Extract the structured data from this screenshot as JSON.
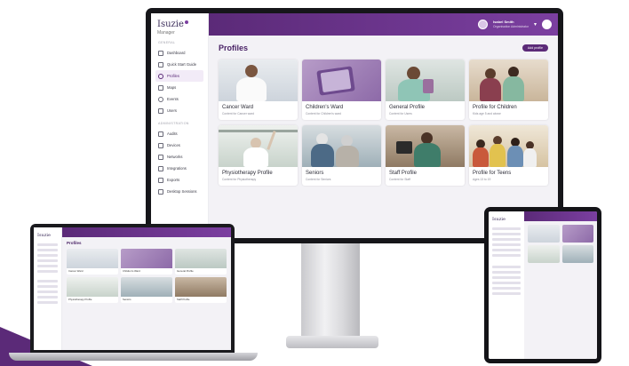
{
  "app": {
    "logo_text": "Isuzie",
    "logo_sub": "Manager",
    "page_title": "Profiles",
    "add_button": "Add profile",
    "user": {
      "name": "Isabel Smith",
      "subtitle": "Organisation Administrator"
    }
  },
  "sidebar": {
    "section_main": "GENERAL",
    "items_main": [
      {
        "label": "Dashboard",
        "icon": "grid-icon"
      },
      {
        "label": "Quick Start Guide",
        "icon": "book-icon"
      },
      {
        "label": "Profiles",
        "icon": "user-icon",
        "active": true
      },
      {
        "label": "Maps",
        "icon": "map-icon"
      },
      {
        "label": "Events",
        "icon": "clock-icon"
      },
      {
        "label": "Users",
        "icon": "users-icon"
      }
    ],
    "section_admin": "ADMINISTRATION",
    "items_admin": [
      {
        "label": "Audits",
        "icon": "list-icon"
      },
      {
        "label": "Devices",
        "icon": "tablet-icon"
      },
      {
        "label": "Networks",
        "icon": "network-icon"
      },
      {
        "label": "Integrations",
        "icon": "plug-icon"
      },
      {
        "label": "Exports",
        "icon": "export-icon"
      },
      {
        "label": "Desktop Sessions",
        "icon": "monitor-icon"
      }
    ]
  },
  "profiles": [
    {
      "title": "Cancer Ward",
      "subtitle": "Content for Cancer ward"
    },
    {
      "title": "Children's Ward",
      "subtitle": "Content for Children's ward"
    },
    {
      "title": "General Profile",
      "subtitle": "Content for Users"
    },
    {
      "title": "Profile for Children",
      "subtitle": "Kids age 5 and above"
    },
    {
      "title": "Physiotherapy Profile",
      "subtitle": "Content for Physiotherapy"
    },
    {
      "title": "Seniors",
      "subtitle": "Content for Seniors"
    },
    {
      "title": "Staff Profile",
      "subtitle": "Content for Staff"
    },
    {
      "title": "Profile for Teens",
      "subtitle": "Ages 13 to 19"
    }
  ],
  "colors": {
    "brand": "#5b2a78",
    "brand_light": "#7b3fa0"
  }
}
